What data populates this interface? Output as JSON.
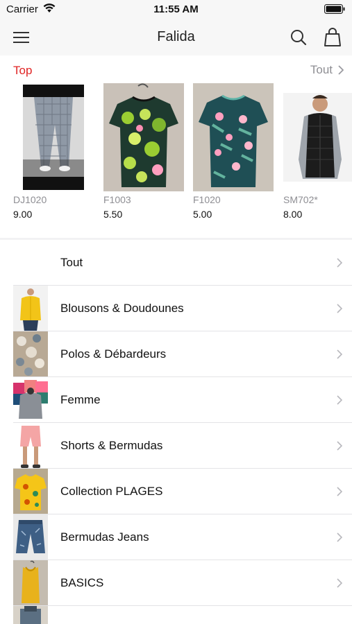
{
  "status_bar": {
    "carrier": "Carrier",
    "time": "11:55 AM"
  },
  "nav": {
    "title": "Falida",
    "menu_icon": "hamburger-menu-icon",
    "search_icon": "search-icon",
    "cart_icon": "shopping-bag-icon"
  },
  "top_section": {
    "label": "Top",
    "see_all": "Tout",
    "accent_color": "#e02424",
    "products": [
      {
        "code": "DJ1020",
        "price": "9.00"
      },
      {
        "code": "F1003",
        "price": "5.50"
      },
      {
        "code": "F1020",
        "price": "5.00"
      },
      {
        "code": "SM702*",
        "price": "8.00"
      }
    ]
  },
  "categories": [
    {
      "label": "Tout"
    },
    {
      "label": "Blousons & Doudounes"
    },
    {
      "label": "Polos & Débardeurs"
    },
    {
      "label": "Femme"
    },
    {
      "label": "Shorts & Bermudas"
    },
    {
      "label": "Collection PLAGES"
    },
    {
      "label": "Bermudas Jeans"
    },
    {
      "label": "BASICS"
    },
    {
      "label": ""
    }
  ]
}
